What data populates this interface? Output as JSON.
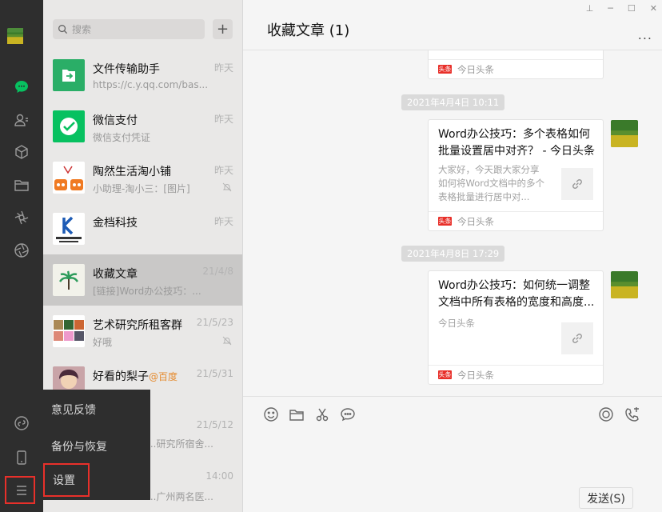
{
  "search": {
    "placeholder": "搜索",
    "plus_label": "+"
  },
  "window": {
    "pin": "⊥",
    "minimize": "─",
    "maximize": "☐",
    "close": "✕"
  },
  "chats": [
    {
      "name": "文件传输助手",
      "preview": "https://c.y.qq.com/bas...",
      "time": "昨天",
      "muted": false
    },
    {
      "name": "微信支付",
      "preview": "微信支付凭证",
      "time": "昨天",
      "muted": false
    },
    {
      "name": "陶然生活淘小铺",
      "preview": "小助理-淘小三：[图片]",
      "time": "昨天",
      "muted": true
    },
    {
      "name": "金档科技",
      "preview": "",
      "time": "昨天",
      "muted": false
    },
    {
      "name": "收藏文章",
      "preview": "[链接]Word办公技巧：...",
      "time": "21/4/8",
      "muted": false
    },
    {
      "name": "艺术研究所租客群",
      "preview": "好哦",
      "time": "21/5/23",
      "muted": true
    },
    {
      "name": "好看的梨子",
      "at": "@百度",
      "preview": "...",
      "time": "21/5/31",
      "muted": false
    },
    {
      "name": "",
      "preview": "...研究所宿舍...",
      "time": "21/5/12",
      "muted": false
    },
    {
      "name": "",
      "preview": "...广州两名医...",
      "time": "14:00",
      "muted": false
    }
  ],
  "menu": {
    "feedback": "意见反馈",
    "backup": "备份与恢复",
    "settings": "设置"
  },
  "conversation": {
    "title": "收藏文章 (1)",
    "more": "...",
    "top_card_source": "今日头条",
    "messages": [
      {
        "timestamp": "2021年4月4日 10:11",
        "title": "Word办公技巧：多个表格如何批量设置居中对齐？ - 今日头条",
        "desc": "大家好，今天跟大家分享如何将Word文档中的多个表格批量进行居中对...",
        "source": "今日头条"
      },
      {
        "timestamp": "2021年4月8日 17:29",
        "title": "Word办公技巧：如何统一调整文档中所有表格的宽度和高度...",
        "desc": "今日头条",
        "source": "今日头条"
      }
    ],
    "source_badge": "头条",
    "send_label": "发送(S)"
  },
  "colors": {
    "rail": "#2e2e2e",
    "list_bg": "#e9e8e7",
    "active_row": "#c9c8c7",
    "highlight_frame": "#e8302a",
    "wechat_green": "#07c160"
  }
}
